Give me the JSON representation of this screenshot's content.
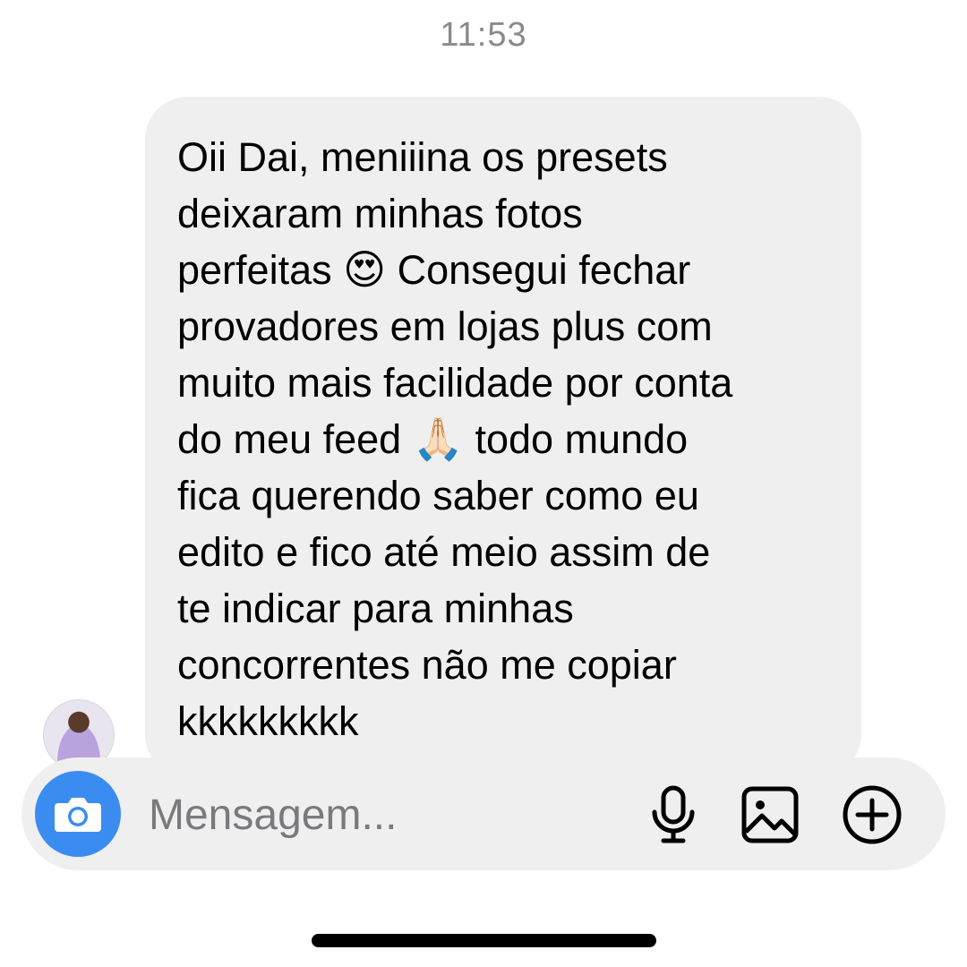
{
  "conversation": {
    "timestamp": "11:53",
    "message": {
      "lines": [
        "Oii Dai, meniiina os presets",
        "deixaram minhas fotos",
        "perfeitas",
        " Consegui fechar",
        "provadores em lojas plus com",
        "muito mais facilidade por conta",
        "do meu feed",
        " todo mundo",
        "fica querendo saber como eu",
        "edito e fico até meio assim de",
        "te indicar para minhas",
        "concorrentes não me copiar",
        "kkkkkkkkk"
      ],
      "emoji_heart_eyes": "😍",
      "emoji_folded_hands": "🙏🏻"
    }
  },
  "composer": {
    "placeholder": "Mensagem...",
    "value": ""
  },
  "icons": {
    "camera": "camera-icon",
    "microphone": "microphone-icon",
    "gallery": "gallery-icon",
    "plus": "plus-circle-icon"
  },
  "colors": {
    "camera_button": "#3b8cf0",
    "bubble": "#efefef",
    "composer": "#efefef",
    "timestamp": "#8a8a8e"
  }
}
